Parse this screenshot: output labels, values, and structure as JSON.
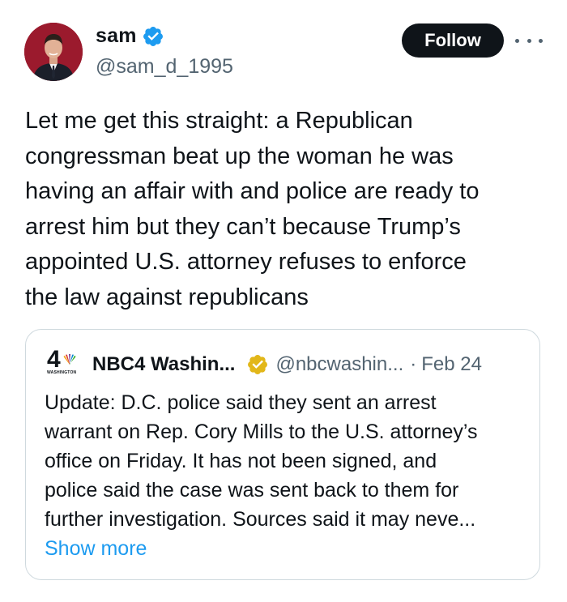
{
  "author": {
    "display_name": "sam",
    "handle": "@sam_d_1995",
    "verified": true
  },
  "actions": {
    "follow_label": "Follow",
    "more_icon": "more-horizontal-icon"
  },
  "tweet": {
    "text": "Let me get this straight: a Republican\ncongressman beat up the woman he was\nhaving an affair with and police are ready to\narrest him but they can’t because Trump’s\nappointed U.S. attorney refuses to enforce\nthe law against republicans"
  },
  "quote": {
    "logo_number": "4",
    "logo_subtext": "WASHINGTON",
    "display_name": "NBC4 Washin...",
    "handle": "@nbcwashin...",
    "separator": "·",
    "date": "Feb 24",
    "text": "Update: D.C. police said they sent an arrest\nwarrant on Rep. Cory Mills to the U.S. attorney’s\noffice on Friday. It has not been signed, and\npolice said the case was sent back to them for\nfurther investigation. Sources said it may neve...",
    "show_more_label": "Show more"
  },
  "colors": {
    "verified_blue": "#1d9bf0",
    "gold_badge": "#e2b719",
    "link_blue": "#1d9bf0",
    "text_primary": "#0f1419",
    "text_secondary": "#536471",
    "border": "#cfd9de"
  }
}
